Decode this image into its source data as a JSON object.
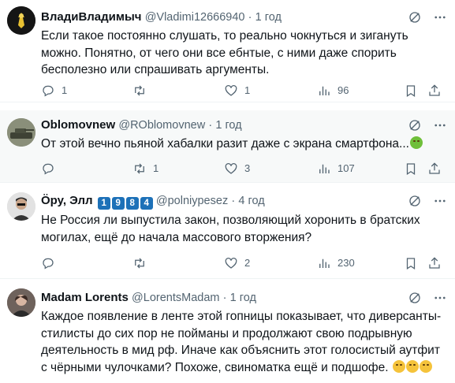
{
  "posts": [
    {
      "name": "ВладиВладимыч",
      "handle": "@Vladimi12666940",
      "time": "1 год",
      "text": "Если такое постоянно слушать, то реально чокнуться и зигануть можно. Понятно, от чего они все ебнтые, с ними даже спорить бесполезно или спрашивать аргументы.",
      "replies": "1",
      "reposts": "",
      "likes": "1",
      "views": "96"
    },
    {
      "name": "Oblomovnew",
      "handle": "@ROblomovnew",
      "time": "1 год",
      "text": "От этой вечно пьяной хабалки разит даже с экрана смартфона...",
      "emoji": "nauseated-face-emoji",
      "replies": "",
      "reposts": "1",
      "likes": "3",
      "views": "107"
    },
    {
      "name": "Öру, Элл",
      "badges": [
        "1",
        "9",
        "8",
        "4"
      ],
      "handle": "@polniypesez",
      "time": "4 год",
      "text": "Не Россия ли выпустила закон, позволяющий хоронить в братских могилах, ещё до начала массового вторжения?",
      "replies": "",
      "reposts": "",
      "likes": "2",
      "views": "230"
    },
    {
      "name": "Madam Lorents",
      "handle": "@LorentsMadam",
      "time": "1 год",
      "text": "Каждое появление в ленте этой гопницы показывает, что диверсанты-стилисты до сих пор не пойманы и продолжают свою подрывную деятельность в мид рф. Иначе как объяснить этот голосистый  аутфит с чёрными чулочками? Похоже, свиноматка ещё и  подшофе.",
      "emoji": "rolling-on-floor-laughing-emoji",
      "emoji_count": 3
    }
  ],
  "separator": "·",
  "colors": {
    "text": "#0f1419",
    "muted": "#536471",
    "divider": "#eff3f4",
    "badge": "#1d71b8"
  }
}
